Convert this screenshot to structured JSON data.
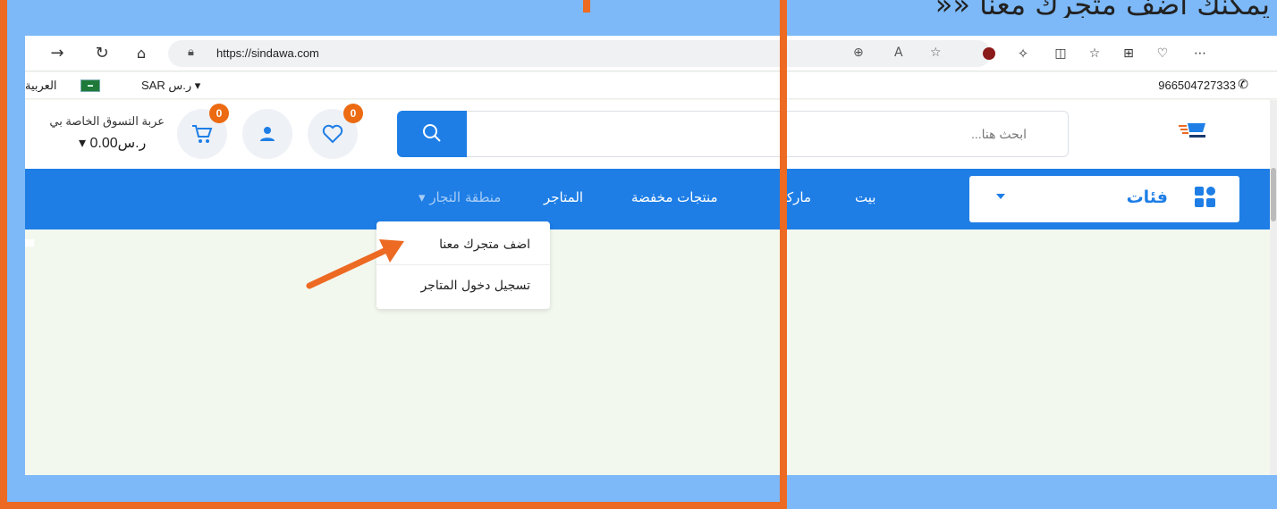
{
  "caption": "يمكنك اضف متجرك معنا ««",
  "browser": {
    "url": "https://sindawa.com",
    "icons": [
      "back-icon",
      "refresh-icon",
      "home-icon",
      "lock-icon",
      "zoom-icon",
      "read-aloud-icon",
      "favorite-icon",
      "extension-icon",
      "puzzle-icon",
      "split-icon",
      "favorites-list-icon",
      "collections-icon",
      "health-icon",
      "more-icon"
    ]
  },
  "infobar": {
    "language": "العربية",
    "currency": "SAR ر.س",
    "phone": "966504727333"
  },
  "header": {
    "cart_title": "عربة التسوق الخاصة بي",
    "cart_amount": "0.00ر.س",
    "cart_count": "0",
    "wishlist_count": "0",
    "search_placeholder": "ابحث هنا..."
  },
  "nav": {
    "categories": "فئات",
    "items": [
      "بيت",
      "ماركة",
      "منتجات مخفضة",
      "المتاجر",
      "منطقة التجار"
    ]
  },
  "dropdown": {
    "items": [
      "اضف متجرك معنا",
      "تسجيل دخول المتاجر"
    ]
  },
  "colors": {
    "primary": "#1e7ee6",
    "accent": "#ec6a22",
    "background": "#7db9f8"
  }
}
